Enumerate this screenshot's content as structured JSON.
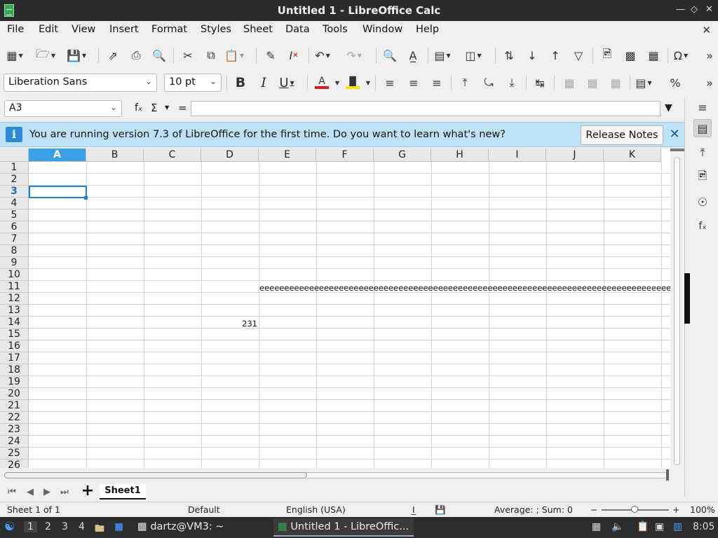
{
  "window": {
    "title": "Untitled 1 - LibreOffice Calc"
  },
  "menu": [
    "File",
    "Edit",
    "View",
    "Insert",
    "Format",
    "Styles",
    "Sheet",
    "Data",
    "Tools",
    "Window",
    "Help"
  ],
  "format_bar": {
    "font_name": "Liberation Sans",
    "font_size": "10 pt"
  },
  "formula_bar": {
    "name_box": "A3",
    "fx_symbol": "fₓ",
    "sum_symbol": "Σ",
    "equals": "=",
    "content": ""
  },
  "infobar": {
    "message": "You are running version 7.3 of LibreOffice for the first time. Do you want to learn what's new?",
    "button": "Release Notes"
  },
  "columns": [
    "A",
    "B",
    "C",
    "D",
    "E",
    "F",
    "G",
    "H",
    "I",
    "J",
    "K"
  ],
  "rows": [
    "1",
    "2",
    "3",
    "4",
    "5",
    "6",
    "7",
    "8",
    "9",
    "10",
    "11",
    "12",
    "13",
    "14",
    "15",
    "16",
    "17",
    "18",
    "19",
    "20",
    "21",
    "22",
    "23",
    "24",
    "25",
    "26"
  ],
  "selected_cell": "A3",
  "cells": {
    "E11": "eeeeeeeeeeeeeeeeeeeeeeeeeeeeeeeeeeeeeeeeeeeeeeeeeeeeeeeeeeeeeeeeeeeeeeeeeeeeeeeeeeeeeeeeeeeeeeeeeeee",
    "D14": "231"
  },
  "sheets": {
    "active": "Sheet1"
  },
  "statusbar": {
    "sheet_info": "Sheet 1 of 1",
    "page_style": "Default",
    "language": "English (USA)",
    "summary": "Average: ; Sum: 0",
    "zoom_minus": "−",
    "zoom_plus": "+",
    "zoom": "100%"
  },
  "taskbar": {
    "workspaces": [
      "1",
      "2",
      "3",
      "4"
    ],
    "terminal": "dartz@VM3: ~",
    "calc_window": "Untitled 1 - LibreOffic...",
    "clock": "8:05"
  },
  "colors": {
    "selection_header": "#3aa0e6",
    "infobar_bg": "#bde2f5",
    "font_color_red": "#d21f1f",
    "highlight_yellow": "#ffe000"
  }
}
